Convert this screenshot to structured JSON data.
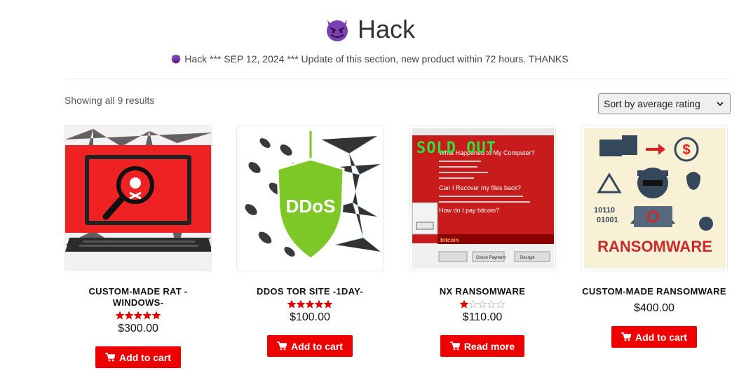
{
  "header": {
    "title": "Hack",
    "notice": "Hack *** SEP 12, 2024 *** Update of this section, new product within 72 hours. THANKS",
    "icon": "smiling-devil-emoji"
  },
  "toolbar": {
    "result_count": "Showing all 9 results",
    "sort_selected": "Sort by average rating"
  },
  "colors": {
    "accent": "#ee0000",
    "star": "#e00000",
    "sold_out": "#2ee03a"
  },
  "products": [
    {
      "title": "CUSTOM-MADE RAT -WINDOWS-",
      "rating": 5,
      "price": "$300.00",
      "button": "Add to cart",
      "sold_out": ""
    },
    {
      "title": "DDOS TOR SITE -1DAY-",
      "rating": 5,
      "price": "$100.00",
      "button": "Add to cart",
      "sold_out": "",
      "image_text": "DDoS"
    },
    {
      "title": "NX RANSOMWARE",
      "rating": 1,
      "price": "$110.00",
      "button": "Read more",
      "sold_out": "SOLD OUT",
      "image_text": [
        "What Happened to My Computer?",
        "Can I Recover my files back?",
        "How do I pay bitcoin?",
        "Check Payment",
        "Decrypt",
        "bitcoin"
      ]
    },
    {
      "title": "CUSTOM-MADE RANSOMWARE",
      "rating": null,
      "price": "$400.00",
      "button": "Add to cart",
      "sold_out": "",
      "image_text": [
        "RANSOMWARE",
        "10110",
        "01001",
        "$"
      ]
    }
  ]
}
